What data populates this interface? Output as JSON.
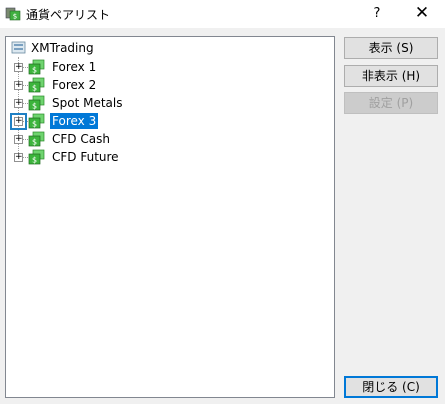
{
  "window": {
    "title": "通貨ペアリスト",
    "help_label": "?",
    "close_label": "✕"
  },
  "tree": {
    "root": {
      "label": "XMTrading",
      "icon": "server-icon"
    },
    "groups": [
      {
        "label": "Forex 1",
        "selected": false
      },
      {
        "label": "Forex 2",
        "selected": false
      },
      {
        "label": "Spot Metals",
        "selected": false
      },
      {
        "label": "Forex 3",
        "selected": true
      },
      {
        "label": "CFD Cash",
        "selected": false
      },
      {
        "label": "CFD Future",
        "selected": false
      }
    ],
    "expander_symbol": "+",
    "group_icon": "folder-dollar-icon"
  },
  "buttons": {
    "show": "表示 (S)",
    "hide": "非表示 (H)",
    "settings": "設定 (P)",
    "close": "閉じる (C)"
  },
  "colors": {
    "selection": "#0078d7",
    "folder_green": "#3cb43c",
    "focus_ring": "#1f80c4"
  }
}
